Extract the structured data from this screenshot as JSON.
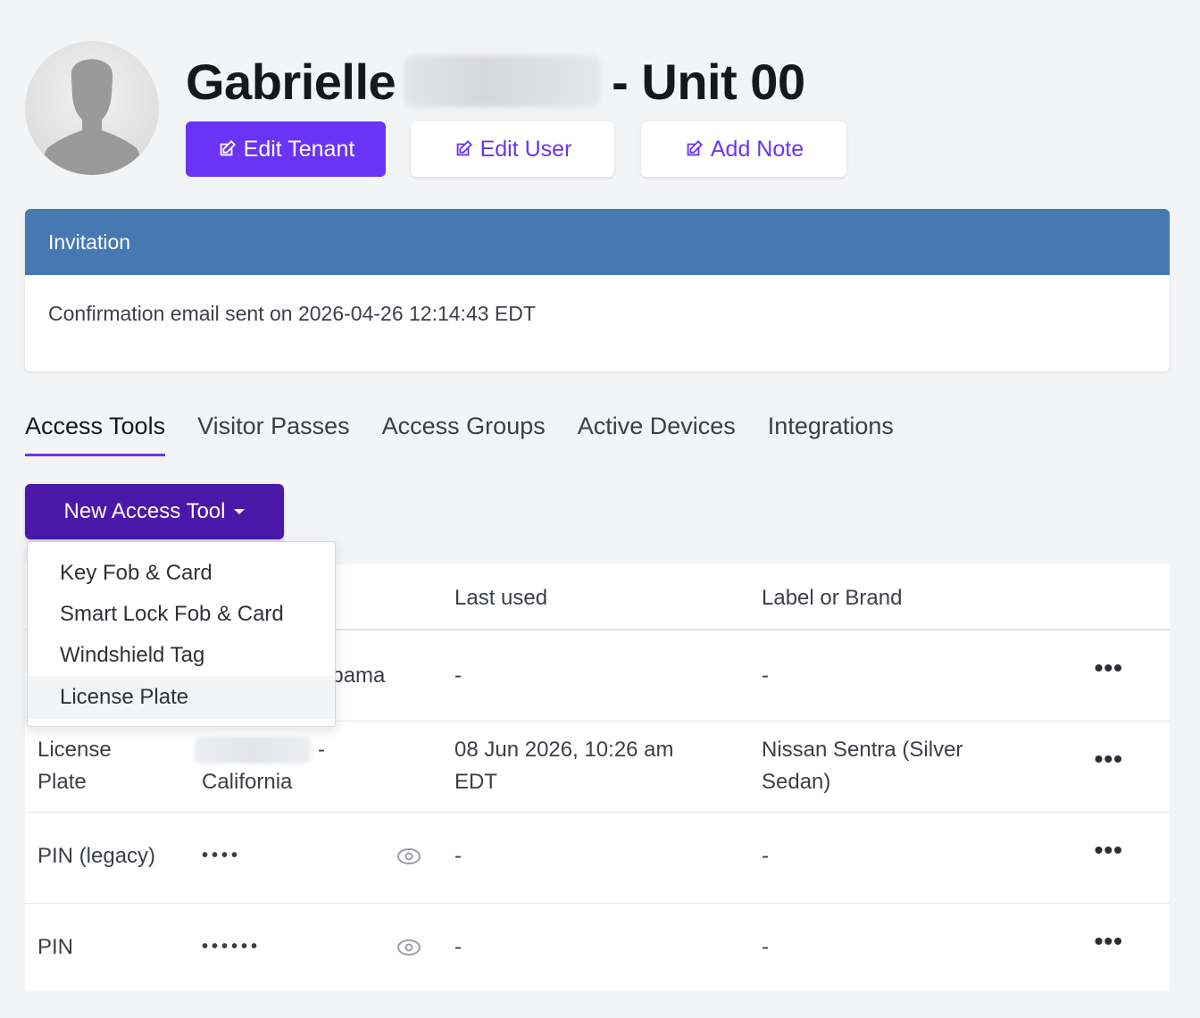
{
  "header": {
    "first_name": "Gabrielle",
    "unit": "- Unit 00",
    "buttons": {
      "edit_tenant": "Edit Tenant",
      "edit_user": "Edit User",
      "add_note": "Add Note"
    }
  },
  "invitation": {
    "title": "Invitation",
    "message": "Confirmation email sent on 2026-04-26 12:14:43 EDT"
  },
  "tabs": [
    "Access Tools",
    "Visitor Passes",
    "Access Groups",
    "Active Devices",
    "Integrations"
  ],
  "new_access_tool_label": "New Access Tool",
  "dropdown_items": [
    "Key Fob & Card",
    "Smart Lock Fob & Card",
    "Windshield Tag",
    "License Plate"
  ],
  "table": {
    "headers": {
      "last_used": "Last used",
      "label": "Label or Brand"
    },
    "rows": [
      {
        "value_fragment": "abama",
        "last_used": "-",
        "label": "-"
      },
      {
        "type_line1": "License",
        "type_line2": "Plate",
        "value_suffix": "-",
        "value_line2": "California",
        "last_used_line1": "08 Jun 2026, 10:26 am",
        "last_used_line2": "EDT",
        "label_line1": "Nissan Sentra (Silver",
        "label_line2": "Sedan)"
      },
      {
        "type": "PIN (legacy)",
        "masked": "••••",
        "last_used": "-",
        "label": "-"
      },
      {
        "type": "PIN",
        "masked": "••••••",
        "last_used": "-",
        "label": "-"
      }
    ],
    "row_menu": "•••"
  },
  "colors": {
    "primary": "#6a33f5",
    "dark_primary": "#4a18a8",
    "card_header": "#4679b2"
  }
}
